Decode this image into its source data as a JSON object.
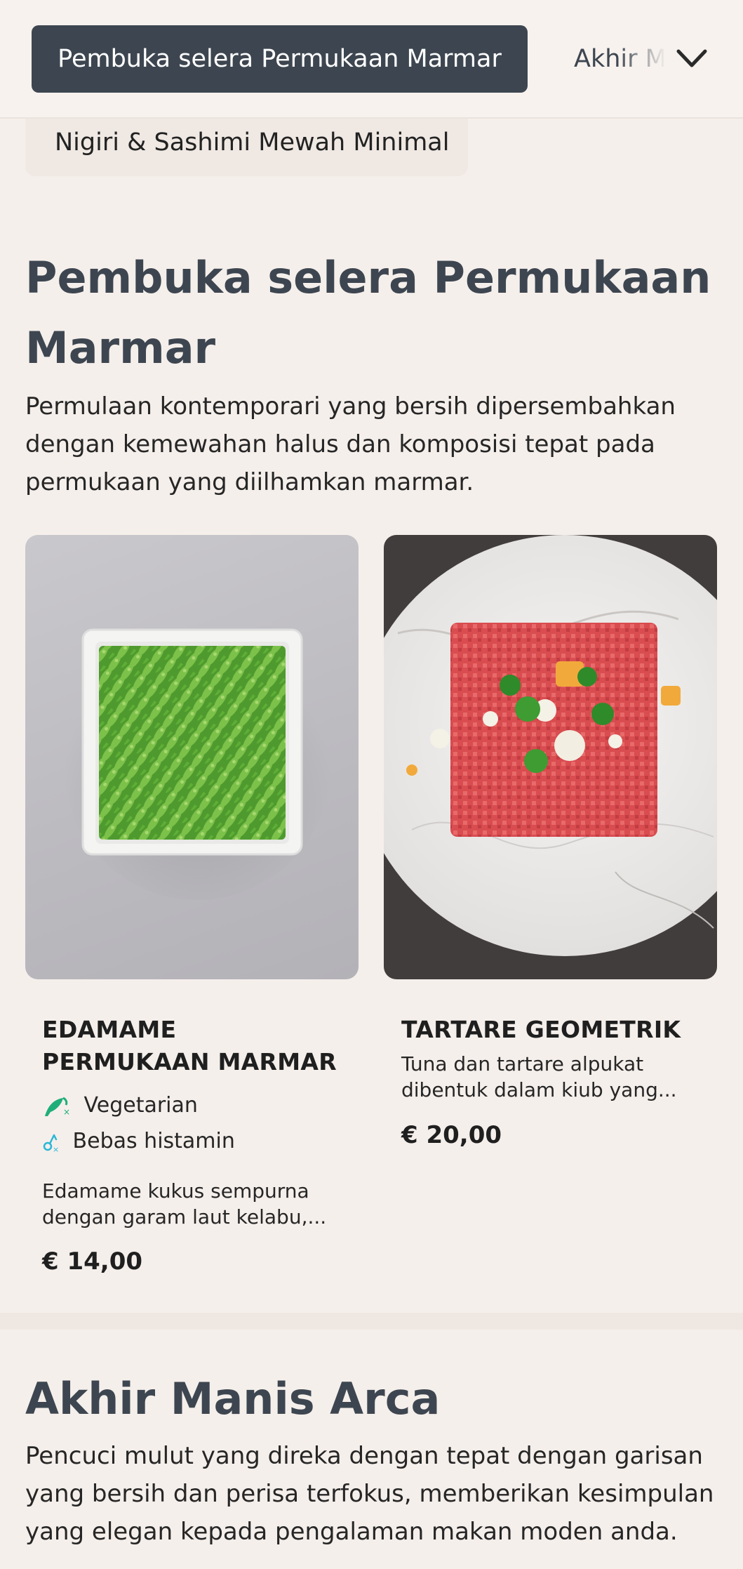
{
  "nav": {
    "active_category": "Pembuka selera Permukaan Marmar",
    "next_category": "Akhir Manis Arca",
    "sub_category": "Nigiri & Sashimi Mewah Minimal"
  },
  "sections": [
    {
      "title": "Pembuka selera Permukaan Marmar",
      "description": "Permulaan kontemporari yang bersih dipersembahkan dengan kemewahan halus dan komposisi tepat pada permukaan yang diilhamkan marmar.",
      "items": [
        {
          "name": "EDAMAME PERMUKAAN MARMAR",
          "tags": [
            {
              "label": "Vegetarian",
              "icon": "vegetarian-icon",
              "color": "#1fae7a"
            },
            {
              "label": "Bebas histamin",
              "icon": "histamine-free-icon",
              "color": "#2ab7d6"
            }
          ],
          "description": "Edamame kukus sempurna dengan garam laut kelabu,...",
          "price": "€ 14,00"
        },
        {
          "name": "TARTARE GEOMETRIK",
          "description": "Tuna dan tartare alpukat dibentuk dalam kiub yang...",
          "price": "€ 20,00"
        }
      ]
    },
    {
      "title": "Akhir Manis Arca",
      "description": "Pencuci mulut yang direka dengan tepat dengan garisan yang bersih dan perisa terfokus, memberikan kesimpulan yang elegan kepada pengalaman makan moden anda."
    }
  ],
  "colors": {
    "accent_dark": "#3d4650",
    "background": "#f5efeb",
    "vegetarian": "#1fae7a",
    "histamine": "#2ab7d6"
  }
}
